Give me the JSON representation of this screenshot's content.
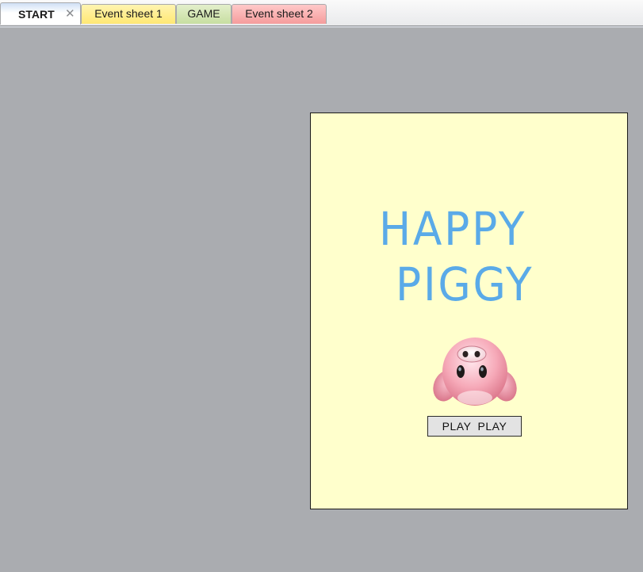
{
  "tabs": [
    {
      "label": "START",
      "active": true,
      "color": "#ffffff"
    },
    {
      "label": "Event sheet 1",
      "active": false,
      "color": "#ffe873"
    },
    {
      "label": "GAME",
      "active": false,
      "color": "#c7dea1"
    },
    {
      "label": "Event sheet 2",
      "active": false,
      "color": "#f59c9c"
    }
  ],
  "tab_close_glyph": "✕",
  "canvas": {
    "background": "#ffffcc",
    "title_line_1": "HAPPY",
    "title_line_2": "PIGGY",
    "title_color": "#5aaae8",
    "sprite_icon": "pig-face-icon",
    "play_button_label": "PLAY  PLAY"
  },
  "workspace_background": "#aaacb0"
}
